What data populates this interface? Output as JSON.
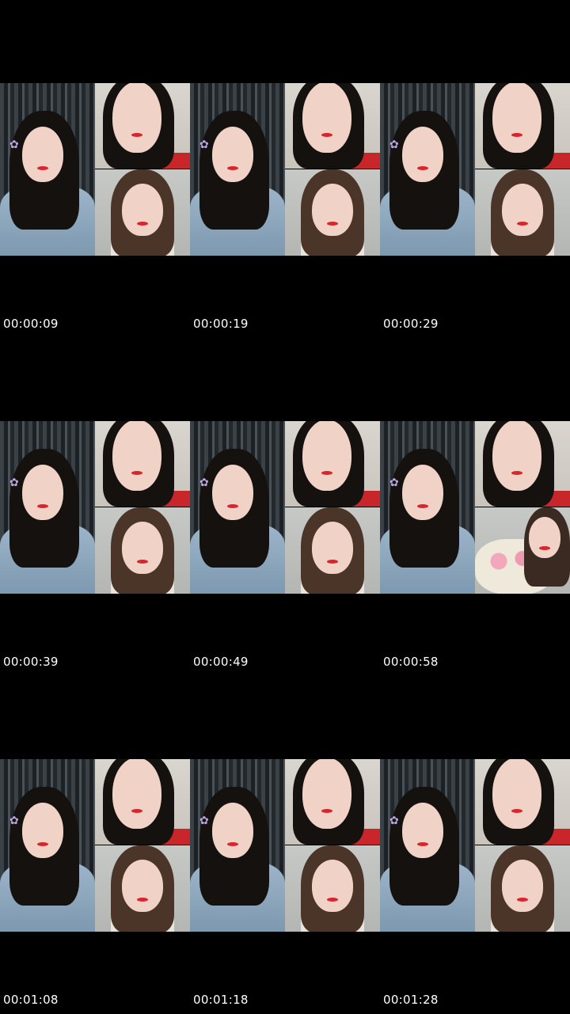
{
  "thumbnails": [
    {
      "timestamp": "00:00:09"
    },
    {
      "timestamp": "00:00:19"
    },
    {
      "timestamp": "00:00:29"
    },
    {
      "timestamp": "00:00:39"
    },
    {
      "timestamp": "00:00:49"
    },
    {
      "timestamp": "00:00:58"
    },
    {
      "timestamp": "00:01:08"
    },
    {
      "timestamp": "00:01:18"
    },
    {
      "timestamp": "00:01:28"
    }
  ]
}
